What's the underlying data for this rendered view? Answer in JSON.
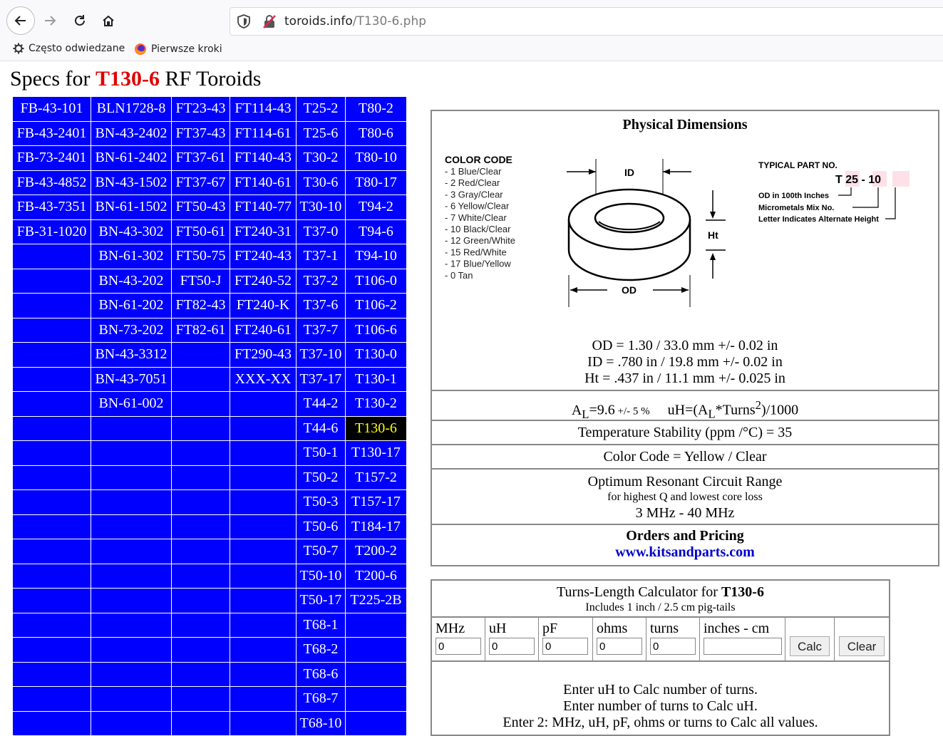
{
  "browser": {
    "url_host": "toroids.info",
    "url_path": "/T130-6.php",
    "bookmarks": [
      {
        "label": "Często odwiedzane"
      },
      {
        "label": "Pierwsze kroki"
      }
    ]
  },
  "page": {
    "title_prefix": "Specs for ",
    "title_part": "T130-6",
    "title_suffix": " RF Toroids"
  },
  "part_grid": {
    "selected": "T130-6",
    "rows": [
      [
        "FB-43-101",
        "BLN1728-8",
        "FT23-43",
        "FT114-43",
        "T25-2",
        "T80-2"
      ],
      [
        "FB-43-2401",
        "BN-43-2402",
        "FT37-43",
        "FT114-61",
        "T25-6",
        "T80-6"
      ],
      [
        "FB-73-2401",
        "BN-61-2402",
        "FT37-61",
        "FT140-43",
        "T30-2",
        "T80-10"
      ],
      [
        "FB-43-4852",
        "BN-43-1502",
        "FT37-67",
        "FT140-61",
        "T30-6",
        "T80-17"
      ],
      [
        "FB-43-7351",
        "BN-61-1502",
        "FT50-43",
        "FT140-77",
        "T30-10",
        "T94-2"
      ],
      [
        "FB-31-1020",
        "BN-43-302",
        "FT50-61",
        "FT240-31",
        "T37-0",
        "T94-6"
      ],
      [
        "",
        "BN-61-302",
        "FT50-75",
        "FT240-43",
        "T37-1",
        "T94-10"
      ],
      [
        "",
        "BN-43-202",
        "FT50-J",
        "FT240-52",
        "T37-2",
        "T106-0"
      ],
      [
        "",
        "BN-61-202",
        "FT82-43",
        "FT240-K",
        "T37-6",
        "T106-2"
      ],
      [
        "",
        "BN-73-202",
        "FT82-61",
        "FT240-61",
        "T37-7",
        "T106-6"
      ],
      [
        "",
        "BN-43-3312",
        "",
        "FT290-43",
        "T37-10",
        "T130-0"
      ],
      [
        "",
        "BN-43-7051",
        "",
        "XXX-XX",
        "T37-17",
        "T130-1"
      ],
      [
        "",
        "BN-61-002",
        "",
        "",
        "T44-2",
        "T130-2"
      ],
      [
        "",
        "",
        "",
        "",
        "T44-6",
        "T130-6"
      ],
      [
        "",
        "",
        "",
        "",
        "T50-1",
        "T130-17"
      ],
      [
        "",
        "",
        "",
        "",
        "T50-2",
        "T157-2"
      ],
      [
        "",
        "",
        "",
        "",
        "T50-3",
        "T157-17"
      ],
      [
        "",
        "",
        "",
        "",
        "T50-6",
        "T184-17"
      ],
      [
        "",
        "",
        "",
        "",
        "T50-7",
        "T200-2"
      ],
      [
        "",
        "",
        "",
        "",
        "T50-10",
        "T200-6"
      ],
      [
        "",
        "",
        "",
        "",
        "T50-17",
        "T225-2B"
      ],
      [
        "",
        "",
        "",
        "",
        "T68-1",
        ""
      ],
      [
        "",
        "",
        "",
        "",
        "T68-2",
        ""
      ],
      [
        "",
        "",
        "",
        "",
        "T68-6",
        ""
      ],
      [
        "",
        "",
        "",
        "",
        "T68-7",
        ""
      ],
      [
        "",
        "",
        "",
        "",
        "T68-10",
        ""
      ]
    ]
  },
  "physical": {
    "title": "Physical Dimensions",
    "color_code_title": "COLOR CODE",
    "color_codes": [
      "- 1   Blue/Clear",
      "- 2   Red/Clear",
      "- 3   Gray/Clear",
      "- 6   Yellow/Clear",
      "- 7   White/Clear",
      "- 10  Black/Clear",
      "- 12  Green/White",
      "- 15  Red/White",
      "- 17  Blue/Yellow",
      "- 0   Tan"
    ],
    "diagram_labels": {
      "id": "ID",
      "od": "OD",
      "ht": "Ht"
    },
    "typical_title": "TYPICAL PART NO.",
    "typical_part": "T 25 - 10",
    "typical_notes": [
      "OD in 100th Inches",
      "Micrometals Mix No.",
      "Letter Indicates Alternate Height"
    ],
    "od": "OD = 1.30 / 33.0 mm +/- 0.02 in",
    "id": "ID = .780 in / 19.8 mm +/- 0.02 in",
    "ht": "Ht = .437 in / 11.1 mm +/- 0.025 in"
  },
  "al": {
    "al_value": "=9.6",
    "al_tol": " +/- 5 %",
    "formula": "uH=(A",
    "formula_tail": "*Turns",
    "formula_end": ")/1000"
  },
  "temp_stability": "Temperature Stability (ppm /°C) = 35",
  "color_code": "Color Code = Yellow / Clear",
  "resonant": {
    "title": "Optimum Resonant Circuit Range",
    "sub": "for highest Q and lowest core loss",
    "range": "3 MHz - 40 MHz"
  },
  "orders": {
    "title": "Orders and Pricing",
    "link": "www.kitsandparts.com"
  },
  "calculator": {
    "title_prefix": "Turns-Length Calculator for ",
    "title_part": "T130-6",
    "sub": "Includes 1 inch / 2.5 cm pig-tails",
    "fields": [
      {
        "label": "MHz",
        "value": "0"
      },
      {
        "label": "uH",
        "value": "0"
      },
      {
        "label": "pF",
        "value": "0"
      },
      {
        "label": "ohms",
        "value": "0"
      },
      {
        "label": "turns",
        "value": "0"
      },
      {
        "label": "inches - cm",
        "value": ""
      }
    ],
    "calc_button": "Calc",
    "clear_button": "Clear",
    "help": [
      "Enter uH to Calc number of turns.",
      "Enter number of turns to Calc uH.",
      "Enter 2: MHz, uH, pF, ohms or turns to Calc all values."
    ]
  }
}
